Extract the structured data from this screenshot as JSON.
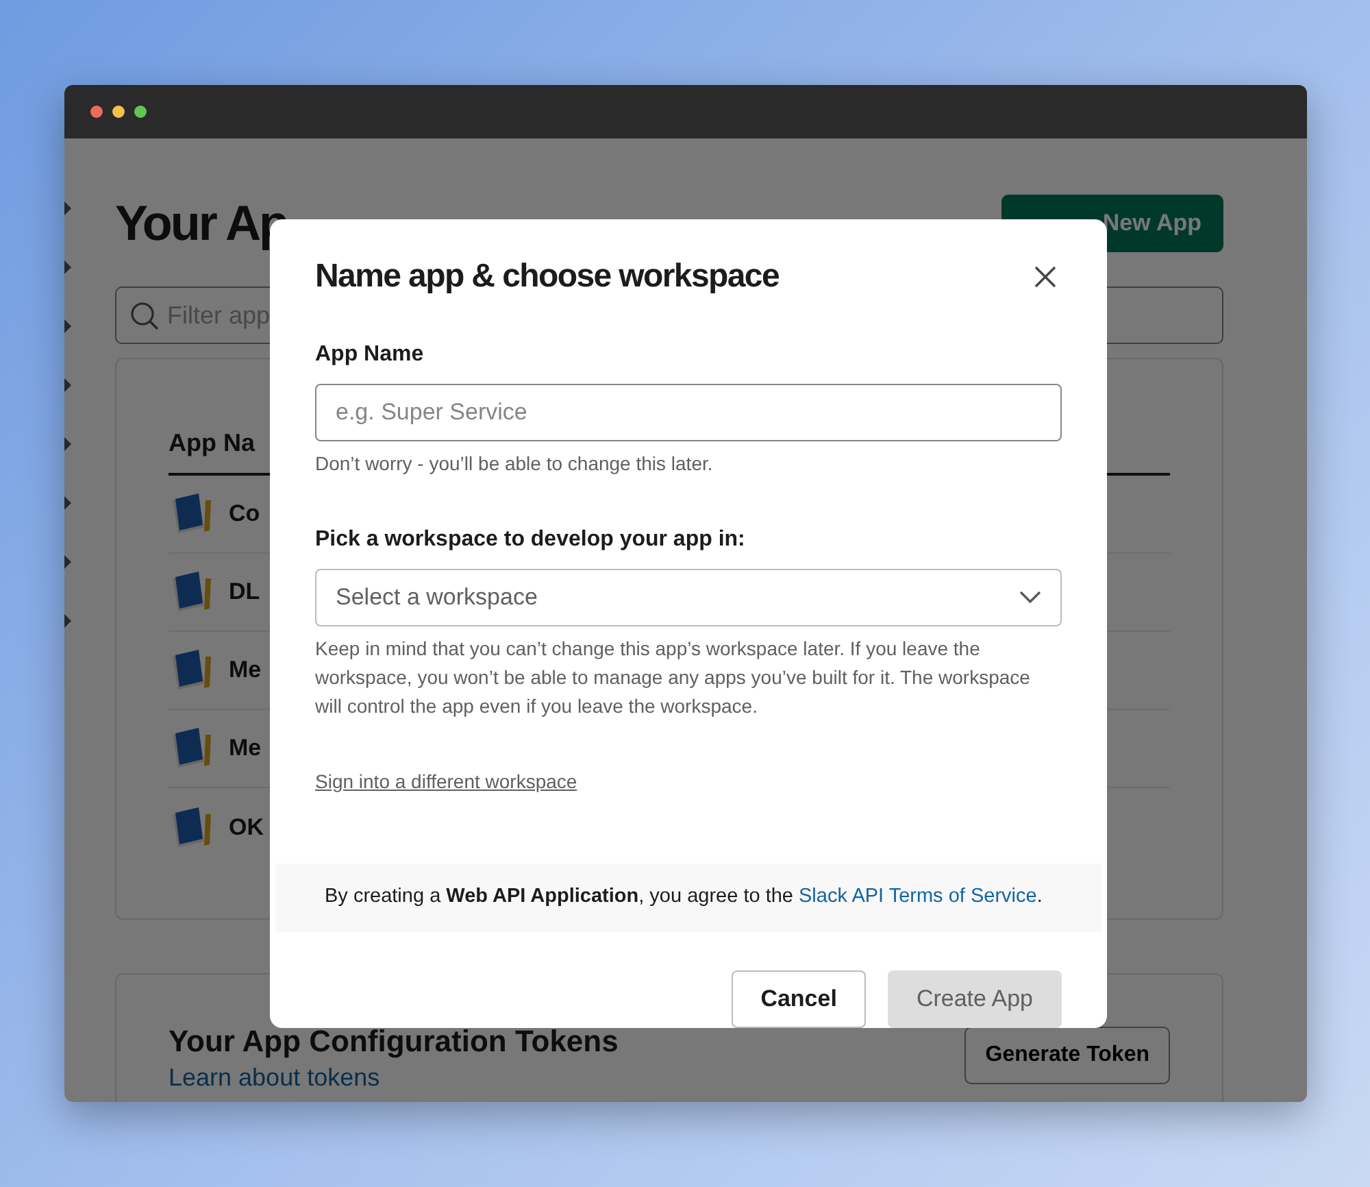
{
  "page": {
    "title": "Your Ap",
    "create_button": "New App",
    "filter": {
      "placeholder": "Filter app"
    },
    "apps_table": {
      "column_1": "App Na",
      "rows": [
        {
          "name": "Co"
        },
        {
          "name": "DL"
        },
        {
          "name": "Me"
        },
        {
          "name": "Me"
        },
        {
          "name": "OK"
        }
      ]
    },
    "tokens": {
      "title": "Your App Configuration Tokens",
      "link": "Learn about tokens",
      "button": "Generate Token"
    }
  },
  "modal": {
    "title": "Name app & choose workspace",
    "fields": [
      {
        "kind": "text",
        "label": "App Name",
        "placeholder": "e.g. Super Service",
        "hint": "Don’t worry - you’ll be able to change this later."
      },
      {
        "kind": "select",
        "label": "Pick a workspace to develop your app in:",
        "placeholder": "Select a workspace",
        "hint": "Keep in mind that you can’t change this app’s workspace later. If you leave the workspace, you won’t be able to manage any apps you’ve built for it. The workspace will control the app even if you leave the workspace."
      }
    ],
    "switch_link": "Sign into a different workspace",
    "terms": {
      "text": "By creating a **Web API Application**, you agree to the ",
      "link": "Slack API Terms of Service",
      "end": "."
    },
    "buttons": [
      {
        "kind": "secondary",
        "label": "Cancel",
        "disabled": false
      },
      {
        "kind": "primary",
        "label": "Create App",
        "disabled": true
      }
    ]
  }
}
